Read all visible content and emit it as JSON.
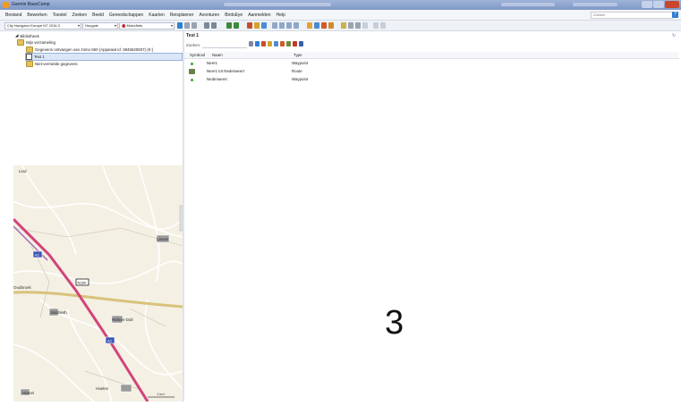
{
  "window": {
    "title": "Garmin BaseCamp"
  },
  "menu": {
    "items": [
      "Bestand",
      "Bewerken",
      "Toestel",
      "Zoeken",
      "Beeld",
      "Gereedschappen",
      "Kaarten",
      "Reisplanner",
      "Avonturen",
      "BirdsEye",
      "Aanmelden",
      "Help"
    ],
    "search_placeholder": "Zoeken",
    "help_label": "?"
  },
  "toolbar": {
    "map_product": "City Navigator Europe NT 2016.3",
    "detail_level": "Hoogste",
    "activity_profile": "Motorfiets"
  },
  "library": {
    "root_label": "Bibliotheek",
    "collection_label": "Mijn verzameling",
    "received_label": "Gegevens ontvangen van zūmo 660 (Apparaat id: 3845620837) (K:)",
    "list_label": "Test 1",
    "unlisted_label": "Niet-vermelde gegevens"
  },
  "map": {
    "labels": [
      "Lind",
      "Lieven",
      "Oudbroek",
      "Babbleth",
      "Retsen-Dall",
      "Hamel",
      "Haelen"
    ],
    "road_badges": [
      "A2",
      "N280",
      "A2"
    ],
    "scale": "1 km"
  },
  "list_panel": {
    "title": "Test 1",
    "search_label": "Zoeken:",
    "refresh_glyph": "↻",
    "columns": [
      "Symbool",
      "Naam",
      "Type"
    ],
    "rows": [
      {
        "name": "Neer1",
        "type": "Waypoint"
      },
      {
        "name": "Neer1 tot Nederweert",
        "type": "Route"
      },
      {
        "name": "Nederweert",
        "type": "Waypoint"
      }
    ]
  },
  "overlay_number": "3",
  "colors": {
    "title_bar": "#7f98c6",
    "highway": "#d2437a",
    "major_road": "#d9c27a"
  }
}
